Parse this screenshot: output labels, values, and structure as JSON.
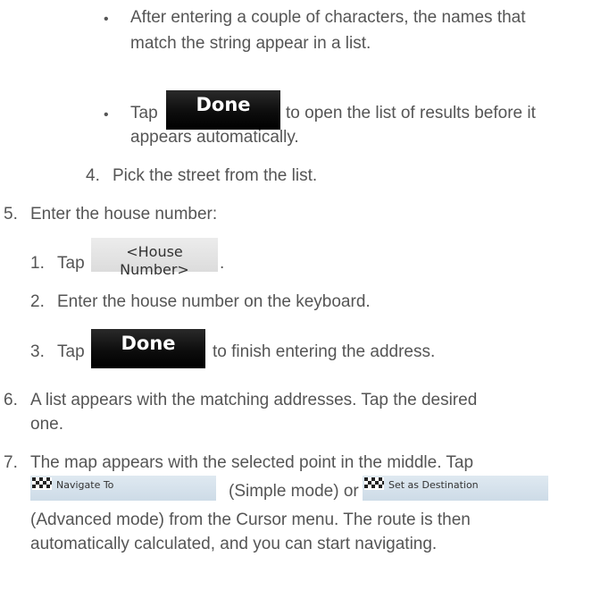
{
  "steps": {
    "bullet_char": "•",
    "bullet1": {
      "line1": "After entering a couple of characters, the names that",
      "line2": "match the string appear in a list."
    },
    "bullet2": {
      "tap": "Tap",
      "after": "to open the list of results before it",
      "line2": "appears automatically."
    },
    "step4": {
      "num": "4.",
      "text": "Pick the street from the list."
    },
    "step5": {
      "num": "5.",
      "text": "Enter the house number:"
    },
    "sub1": {
      "num": "1.",
      "tap": "Tap",
      "after": "."
    },
    "sub2": {
      "num": "2.",
      "text": "Enter the house number on the keyboard."
    },
    "sub3": {
      "num": "3.",
      "tap": "Tap",
      "after": "to finish entering the address."
    },
    "step6": {
      "num": "6.",
      "line1": "A list appears with the matching addresses. Tap the desired",
      "line2": "one."
    },
    "step7": {
      "num": "7.",
      "line1": "The map appears with the selected point in the middle. Tap",
      "mid": "(Simple mode) or",
      "line3": "(Advanced mode) from the Cursor menu. The route is then",
      "line4": "automatically calculated, and you can start navigating."
    }
  },
  "buttons": {
    "done": "Done",
    "house_number": "<House Number>",
    "navigate_to": "Navigate To",
    "set_as_destination": "Set as Destination"
  },
  "icons": {
    "flag": "checkered-flag-icon"
  },
  "colors": {
    "text": "#555555",
    "done_bg": "#000000",
    "done_text": "#ffffff",
    "house_bg": "#e4e4e4",
    "nav_bg": "#d6e2ec"
  }
}
